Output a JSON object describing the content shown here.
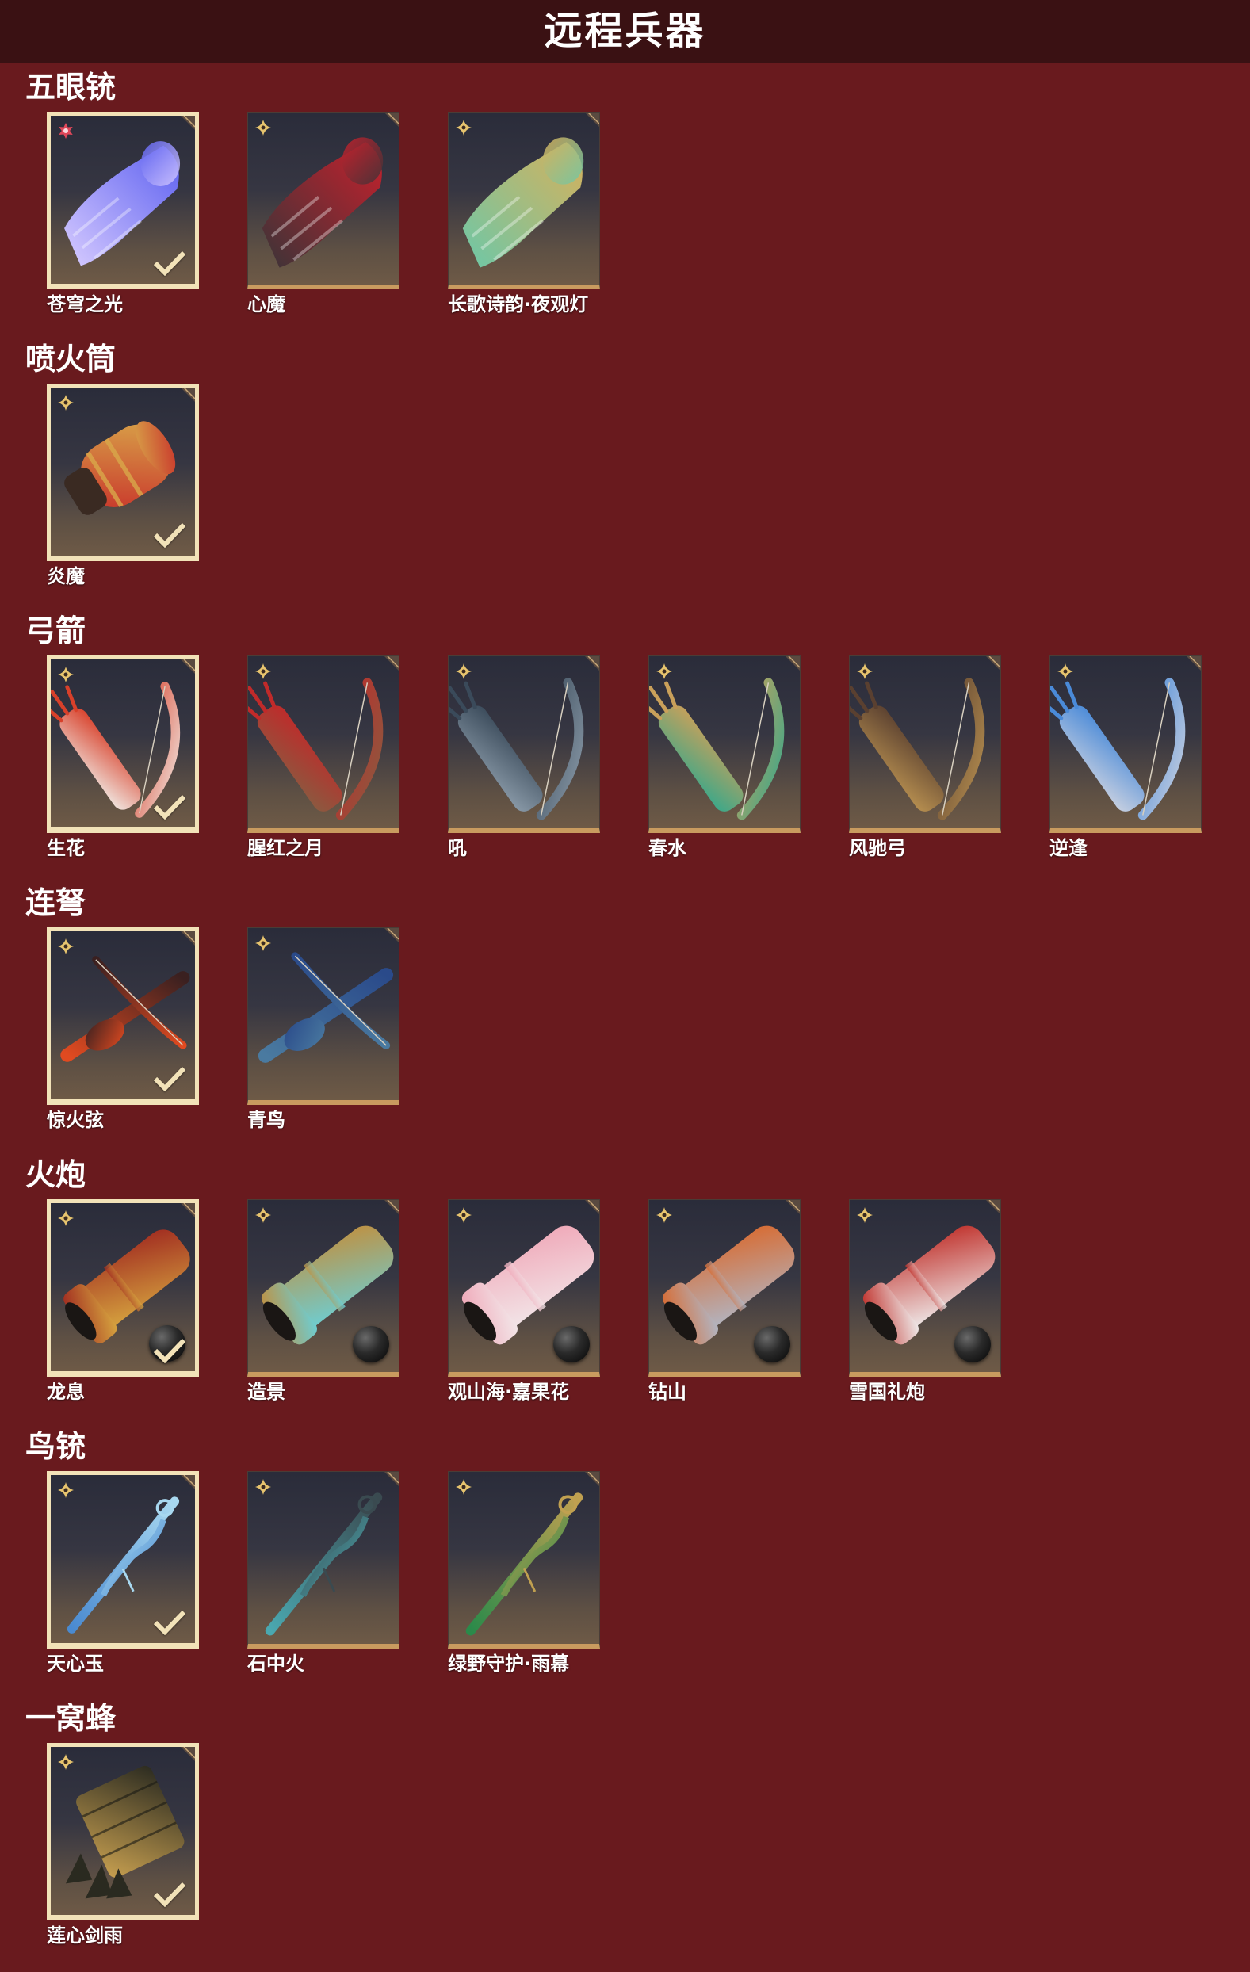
{
  "title": "远程兵器",
  "colors": {
    "background": "#691a1e",
    "title_bar": "#3a1113",
    "text": "#ffffff",
    "selected_frame": "#f2e2b8",
    "card_bottom_edge": "#c99b5f",
    "badge_gold": "#e7c46e",
    "badge_red": "#e0485a"
  },
  "sections": [
    {
      "name": "五眼铳",
      "items": [
        {
          "name": "苍穹之光",
          "selected": true,
          "badge_icon": "red-star-icon",
          "palette": [
            "#d8ccff",
            "#5a5ef0"
          ]
        },
        {
          "name": "心魔",
          "selected": false,
          "badge_icon": "gold-star-icon",
          "palette": [
            "#3a3438",
            "#c8202c"
          ]
        },
        {
          "name": "长歌诗韵·夜观灯",
          "selected": false,
          "badge_icon": "gold-star-icon",
          "palette": [
            "#6cc8a8",
            "#d8b05a"
          ]
        }
      ]
    },
    {
      "name": "喷火筒",
      "items": [
        {
          "name": "炎魔",
          "selected": true,
          "badge_icon": "gold-star-icon",
          "palette": [
            "#c8302a",
            "#d9a84a"
          ]
        }
      ]
    },
    {
      "name": "弓箭",
      "items": [
        {
          "name": "生花",
          "selected": true,
          "badge_icon": "gold-star-icon",
          "palette": [
            "#f0e6e0",
            "#d8402a"
          ]
        },
        {
          "name": "腥红之月",
          "selected": false,
          "badge_icon": "gold-star-icon",
          "palette": [
            "#8a5a40",
            "#c02a2a"
          ]
        },
        {
          "name": "吼",
          "selected": false,
          "badge_icon": "gold-star-icon",
          "palette": [
            "#8a9aa8",
            "#3a4a5a"
          ]
        },
        {
          "name": "春水",
          "selected": false,
          "badge_icon": "gold-star-icon",
          "palette": [
            "#3aa88a",
            "#c9a05a"
          ]
        },
        {
          "name": "风驰弓",
          "selected": false,
          "badge_icon": "gold-star-icon",
          "palette": [
            "#b89050",
            "#5a4030"
          ]
        },
        {
          "name": "逆逢",
          "selected": false,
          "badge_icon": "gold-star-icon",
          "palette": [
            "#c8d0e0",
            "#4a8ad8"
          ]
        }
      ]
    },
    {
      "name": "连弩",
      "items": [
        {
          "name": "惊火弦",
          "selected": true,
          "badge_icon": "gold-star-icon",
          "palette": [
            "#e04a20",
            "#3a2020"
          ]
        },
        {
          "name": "青鸟",
          "selected": false,
          "badge_icon": "gold-star-icon",
          "palette": [
            "#4a7aa0",
            "#2a4a8a"
          ]
        }
      ]
    },
    {
      "name": "火炮",
      "items": [
        {
          "name": "龙息",
          "selected": true,
          "badge_icon": "gold-star-icon",
          "ammo_icon": "cannonball-icon",
          "palette": [
            "#d8a840",
            "#a02a20"
          ]
        },
        {
          "name": "造景",
          "selected": false,
          "badge_icon": "gold-star-icon",
          "ammo_icon": "cannonball-icon",
          "palette": [
            "#6ad0d8",
            "#c09040"
          ]
        },
        {
          "name": "观山海·嘉果花",
          "selected": false,
          "badge_icon": "gold-star-icon",
          "ammo_icon": "cannonball-icon",
          "palette": [
            "#f2e8ea",
            "#f0a8b8"
          ]
        },
        {
          "name": "钻山",
          "selected": false,
          "badge_icon": "gold-star-icon",
          "ammo_icon": "cannonball-icon",
          "palette": [
            "#b0b8c8",
            "#d86a30"
          ]
        },
        {
          "name": "雪国礼炮",
          "selected": false,
          "badge_icon": "gold-star-icon",
          "ammo_icon": "cannonball-icon",
          "palette": [
            "#f0f0f0",
            "#c0302a"
          ]
        }
      ]
    },
    {
      "name": "鸟铳",
      "items": [
        {
          "name": "天心玉",
          "selected": true,
          "badge_icon": "gold-star-icon",
          "palette": [
            "#4a8ad0",
            "#a8d8f0"
          ]
        },
        {
          "name": "石中火",
          "selected": false,
          "badge_icon": "gold-star-icon",
          "palette": [
            "#4aa8b0",
            "#3a4a50"
          ]
        },
        {
          "name": "绿野守护·雨幕",
          "selected": false,
          "badge_icon": "gold-star-icon",
          "palette": [
            "#2a8a4a",
            "#c0a050"
          ]
        }
      ]
    },
    {
      "name": "一窝蜂",
      "items": [
        {
          "name": "莲心剑雨",
          "selected": true,
          "badge_icon": "gold-star-icon",
          "palette": [
            "#c8a050",
            "#2a2a20"
          ]
        }
      ]
    }
  ]
}
